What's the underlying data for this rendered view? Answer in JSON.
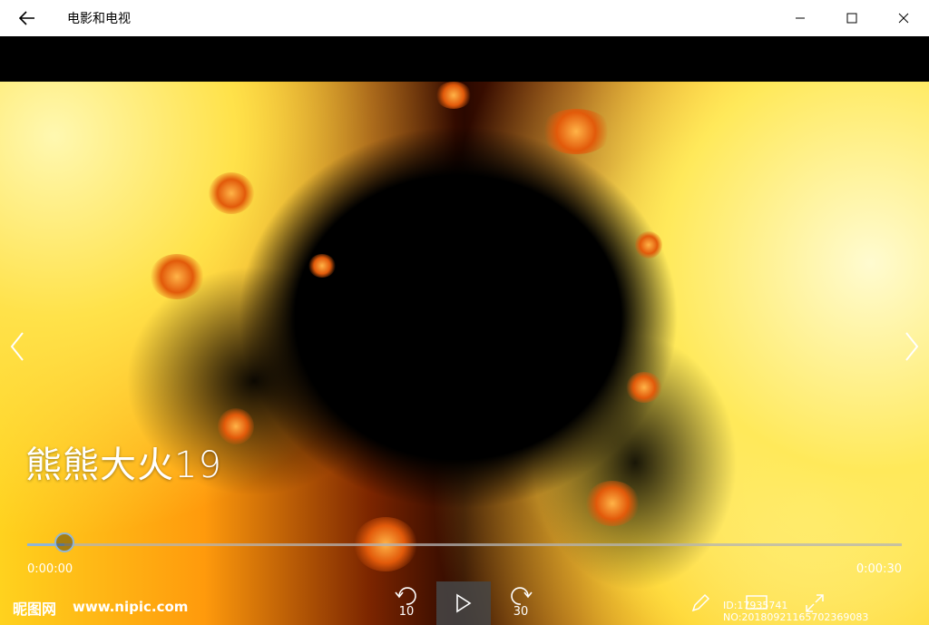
{
  "window": {
    "title": "电影和电视",
    "back_icon": "back-arrow-icon",
    "minimize_icon": "minimize-icon",
    "maximize_icon": "maximize-icon",
    "close_icon": "close-icon"
  },
  "player": {
    "video_title": "熊熊大火19",
    "current_time": "0:00:00",
    "duration": "0:00:30",
    "progress_fraction": 0.043,
    "skip_back_seconds": "10",
    "skip_forward_seconds": "30",
    "accent_color": "#8fb5d8"
  },
  "watermark": {
    "site_cn": "昵图网",
    "site_url": "www.nipic.com",
    "id_text": "ID:17935741 NO:20180921165702369083"
  }
}
